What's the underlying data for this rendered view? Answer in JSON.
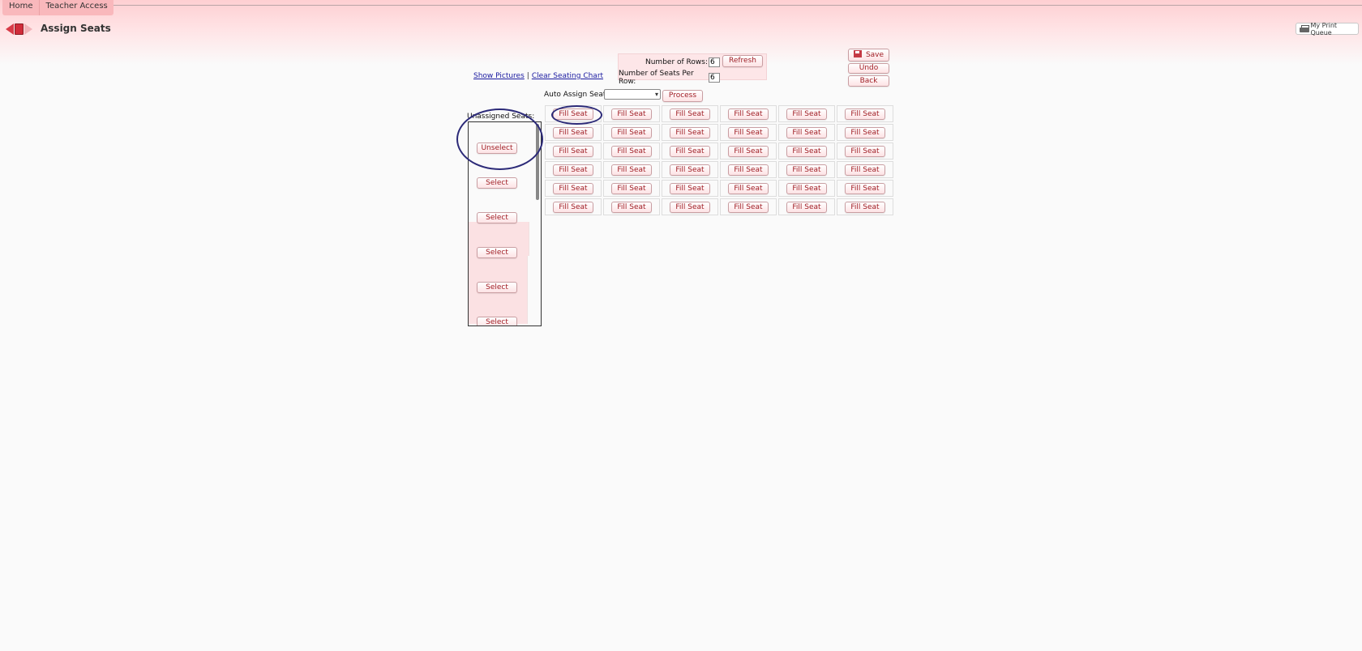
{
  "tabs": [
    "Home",
    "Teacher Access"
  ],
  "header": {
    "title": "Assign Seats",
    "print_queue": "My Print Queue"
  },
  "links": {
    "show_pictures": "Show Pictures",
    "separator": "|",
    "clear_chart": "Clear Seating Chart"
  },
  "config": {
    "rows_label": "Number of Rows:",
    "rows_value": "6",
    "seats_label": "Number of Seats Per Row:",
    "seats_value": "6",
    "refresh": "Refresh"
  },
  "actions": {
    "save": "Save",
    "undo": "Undo",
    "back": "Back"
  },
  "auto_assign": {
    "label": "Auto Assign Seats:",
    "selected": "",
    "process": "Process"
  },
  "unassigned": {
    "label": "Unassigned Seats:",
    "buttons": [
      "Unselect",
      "Select",
      "Select",
      "Select",
      "Select",
      "Select"
    ]
  },
  "seating": {
    "fill_label": "Fill Seat",
    "rows": 6,
    "cols": 6
  },
  "colors": {
    "accent": "#a01e25",
    "band": "#fecfd2",
    "annotation": "#2c2a78"
  }
}
